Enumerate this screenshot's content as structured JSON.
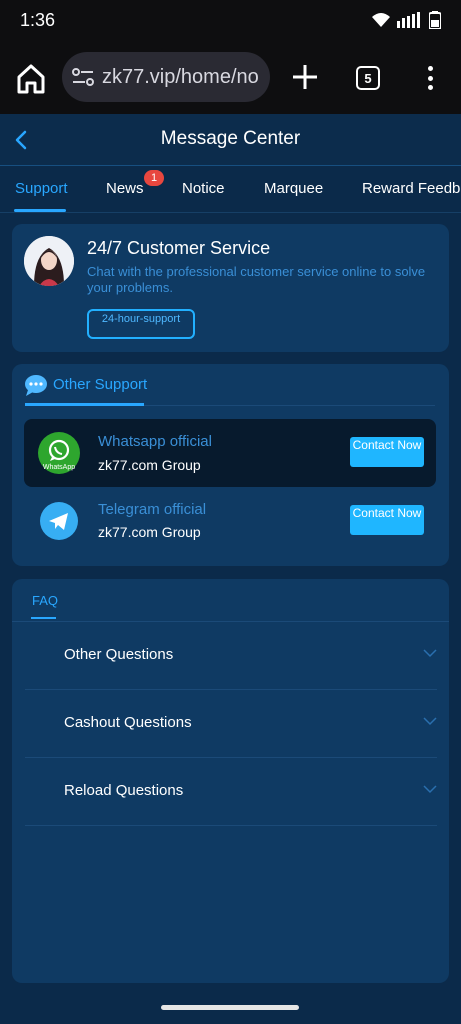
{
  "status_bar": {
    "time": "1:36",
    "icons": [
      "wifi-icon",
      "signal-icon",
      "battery-icon"
    ]
  },
  "browser": {
    "url": "zk77.vip/home/no",
    "tab_count": "5"
  },
  "header": {
    "title": "Message Center"
  },
  "tabs": [
    {
      "label": "Support",
      "active": true
    },
    {
      "label": "News",
      "badge": "1"
    },
    {
      "label": "Notice"
    },
    {
      "label": "Marquee"
    },
    {
      "label": "Reward Feedb"
    }
  ],
  "customer_service": {
    "title": "24/7 Customer Service",
    "description": "Chat with the professional customer service online to solve your problems.",
    "button_label": "24-hour-support"
  },
  "other_support": {
    "title": "Other Support",
    "contacts": [
      {
        "name": "Whatsapp official",
        "group": "zk77.com Group",
        "button": "Contact Now",
        "icon_text": "WhatsApp",
        "icon": "whatsapp-icon"
      },
      {
        "name": "Telegram official",
        "group": "zk77.com Group",
        "button": "Contact Now",
        "icon": "telegram-icon"
      }
    ]
  },
  "faq": {
    "tab": "FAQ",
    "items": [
      "Other Questions",
      "Cashout Questions",
      "Reload Questions"
    ]
  },
  "colors": {
    "background": "#0b2a4a",
    "card": "#0f3a63",
    "accent": "#29a7ff",
    "button": "#1fb6ff",
    "badge": "#e8473f"
  }
}
